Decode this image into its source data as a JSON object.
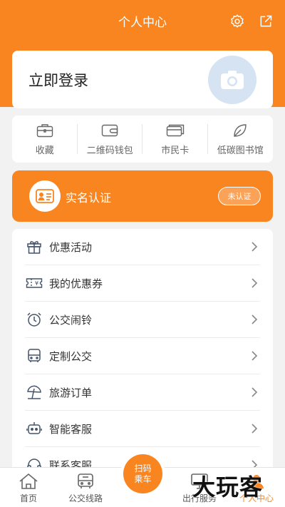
{
  "header": {
    "title": "个人中心",
    "settings_icon": "gear-icon",
    "share_icon": "external-link-icon"
  },
  "login": {
    "text": "立即登录",
    "avatar_icon": "camera-icon"
  },
  "quick_actions": [
    {
      "label": "收藏",
      "icon": "briefcase-icon"
    },
    {
      "label": "二维码钱包",
      "icon": "wallet-icon"
    },
    {
      "label": "市民卡",
      "icon": "card-icon"
    },
    {
      "label": "低碳图书馆",
      "icon": "leaf-icon"
    }
  ],
  "verify": {
    "text": "实名认证",
    "status": "未认证",
    "icon": "id-card-icon"
  },
  "menu": [
    {
      "label": "优惠活动",
      "icon": "gift-icon"
    },
    {
      "label": "我的优惠券",
      "icon": "coupon-icon"
    },
    {
      "label": "公交闹铃",
      "icon": "alarm-clock-icon"
    },
    {
      "label": "定制公交",
      "icon": "bus-icon"
    },
    {
      "label": "旅游订单",
      "icon": "beach-umbrella-icon"
    },
    {
      "label": "智能客服",
      "icon": "robot-icon"
    },
    {
      "label": "联系客服",
      "icon": "headset-icon"
    }
  ],
  "tabbar": {
    "home": "首页",
    "bus_lines": "公交线路",
    "scan_line1": "扫码",
    "scan_line2": "乘车",
    "travel": "出行服务",
    "profile": "个人中心"
  },
  "watermark": "大玩客",
  "colors": {
    "accent": "#f98520",
    "background": "#f2f2f2",
    "avatar_bg": "#d6e3f2"
  }
}
